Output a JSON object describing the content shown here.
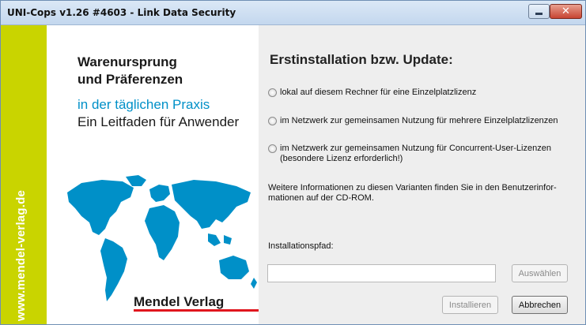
{
  "window": {
    "title": "UNI-Cops v1.26 #4603 - Link Data Security",
    "close_glyph": "✕"
  },
  "sidebar": {
    "url_text": "www.mendel-verlag.de",
    "color": "#c9d400"
  },
  "cover": {
    "title_line1": "Warenursprung",
    "title_line2": "und Präferenzen",
    "subtitle": "in der täglichen Praxis",
    "tagline": "Ein Leitfaden für Anwender",
    "publisher": "Mendel Verlag",
    "accent_color": "#0090c8",
    "map_icon": "world-map-icon"
  },
  "installer": {
    "heading": "Erstinstallation bzw. Update:",
    "options": [
      {
        "label": "lokal auf diesem Rechner für eine Einzelplatzlizenz"
      },
      {
        "label": "im Netzwerk zur gemeinsamen Nutzung für mehrere Einzelplatzlizenzen"
      },
      {
        "label_line1": "im Netzwerk zur gemeinsamen Nutzung für Concurrent-User-Lizenzen",
        "label_line2": "(besondere Lizenz erforderlich!)"
      }
    ],
    "info_line1": "Weitere Informationen zu diesen Varianten finden Sie in den Benutzerinfor-",
    "info_line2": "mationen auf der CD-ROM.",
    "path_label": "Installationspfad:",
    "path_value": "",
    "browse_label": "Auswählen",
    "install_label": "Installieren",
    "cancel_label": "Abbrechen"
  }
}
